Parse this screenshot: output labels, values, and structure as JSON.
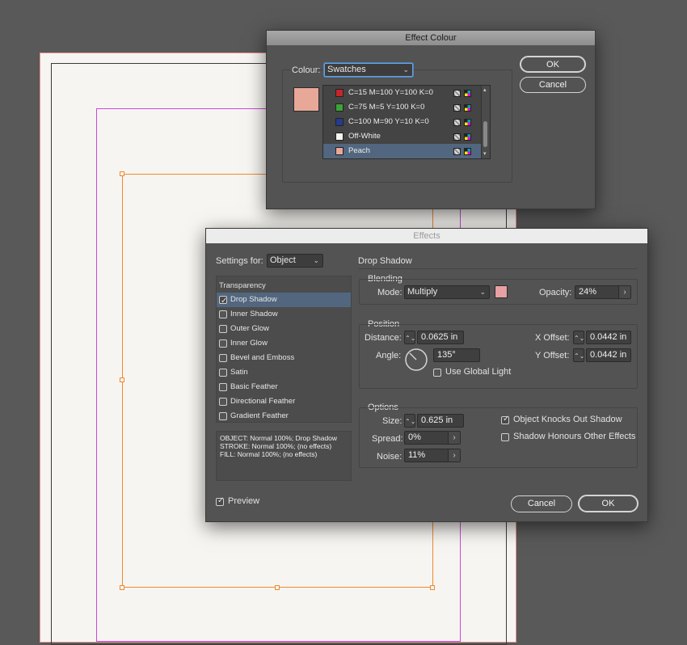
{
  "effect_colour_dialog": {
    "title": "Effect Colour",
    "colour_label": "Colour:",
    "colour_value": "Swatches",
    "ok_label": "OK",
    "cancel_label": "Cancel",
    "preview_color": "#e8a898",
    "swatches": [
      {
        "name": "C=15 M=100 Y=100 K=0",
        "color": "#c4262b",
        "selected": false
      },
      {
        "name": "C=75 M=5 Y=100 K=0",
        "color": "#3ba338",
        "selected": false
      },
      {
        "name": "C=100 M=90 Y=10 K=0",
        "color": "#263a8f",
        "selected": false
      },
      {
        "name": "Off-White",
        "color": "#f7f5f1",
        "selected": false
      },
      {
        "name": "Peach",
        "color": "#e8a898",
        "selected": true
      }
    ]
  },
  "effects_dialog": {
    "title": "Effects",
    "settings_for_label": "Settings for:",
    "settings_for_value": "Object",
    "transparency_label": "Transparency",
    "effects_list": [
      {
        "label": "Drop Shadow",
        "checked": true,
        "selected": true
      },
      {
        "label": "Inner Shadow",
        "checked": false,
        "selected": false
      },
      {
        "label": "Outer Glow",
        "checked": false,
        "selected": false
      },
      {
        "label": "Inner Glow",
        "checked": false,
        "selected": false
      },
      {
        "label": "Bevel and Emboss",
        "checked": false,
        "selected": false
      },
      {
        "label": "Satin",
        "checked": false,
        "selected": false
      },
      {
        "label": "Basic Feather",
        "checked": false,
        "selected": false
      },
      {
        "label": "Directional Feather",
        "checked": false,
        "selected": false
      },
      {
        "label": "Gradient Feather",
        "checked": false,
        "selected": false
      }
    ],
    "summary": [
      "OBJECT: Normal 100%; Drop Shadow",
      "STROKE: Normal 100%; (no effects)",
      "FILL: Normal 100%; (no effects)"
    ],
    "preview_label": "Preview",
    "preview_checked": true,
    "panel_title": "Drop Shadow",
    "blending": {
      "heading": "Blending",
      "mode_label": "Mode:",
      "mode_value": "Multiply",
      "color": "#e8a0a2",
      "opacity_label": "Opacity:",
      "opacity_value": "24%"
    },
    "position": {
      "heading": "Position",
      "distance_label": "Distance:",
      "distance_value": "0.0625 in",
      "angle_label": "Angle:",
      "angle_value": "135°",
      "use_global_light_label": "Use Global Light",
      "use_global_light_checked": false,
      "x_offset_label": "X Offset:",
      "x_offset_value": "0.0442 in",
      "y_offset_label": "Y Offset:",
      "y_offset_value": "0.0442 in"
    },
    "options": {
      "heading": "Options",
      "size_label": "Size:",
      "size_value": "0.625 in",
      "spread_label": "Spread:",
      "spread_value": "0%",
      "noise_label": "Noise:",
      "noise_value": "11%",
      "knocks_out_label": "Object Knocks Out Shadow",
      "knocks_out_checked": true,
      "honours_label": "Shadow Honours Other Effects",
      "honours_checked": false
    },
    "cancel_label": "Cancel",
    "ok_label": "OK"
  }
}
